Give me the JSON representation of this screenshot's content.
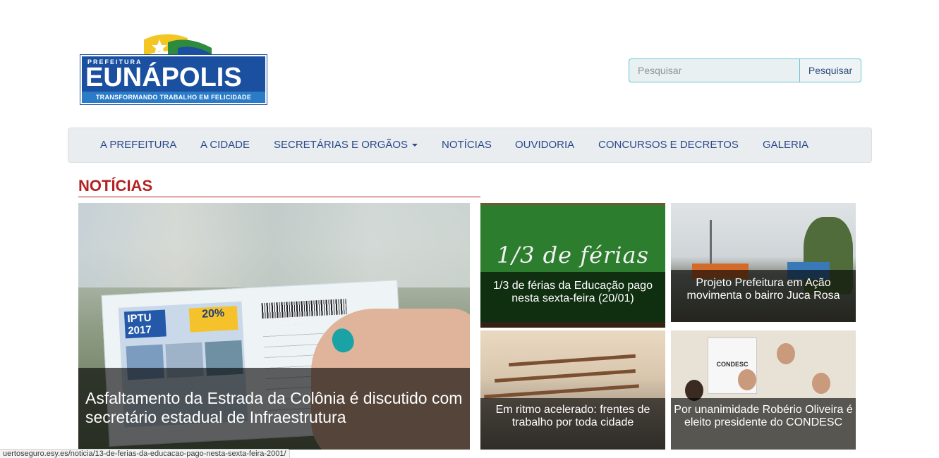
{
  "logo": {
    "prefix": "PREFEITURA",
    "name": "EUNÁPOLIS",
    "slogan": "TRANSFORMANDO TRABALHO EM FELICIDADE"
  },
  "search": {
    "placeholder": "Pesquisar",
    "button_label": "Pesquisar"
  },
  "nav": {
    "items": [
      "A PREFEITURA",
      "A CIDADE",
      "SECRETÁRIAS E ORGÃOS",
      "NOTÍCIAS",
      "OUVIDORIA",
      "CONCURSOS E DECRETOS",
      "GALERIA"
    ]
  },
  "news": {
    "section_title": "NOTÍCIAS",
    "featured": {
      "caption": "Asfaltamento da Estrada da Colônia é discutido com secretário estadual de Infraestrutura",
      "image_text": {
        "iptu": "IPTU 2017",
        "discount": "20%"
      }
    },
    "items": [
      {
        "caption": "1/3 de férias da Educação pago nesta sexta-feira (20/01)",
        "image_text": "1/3 de férias"
      },
      {
        "caption": "Projeto Prefeitura em Ação movimenta o bairro Juca Rosa"
      },
      {
        "caption": "Em ritmo acelerado: frentes de trabalho por toda cidade"
      },
      {
        "caption": "Por unanimidade Robério Oliveira é eleito presidente do CONDESC",
        "image_text": "CONDESC"
      }
    ]
  },
  "status_bar": {
    "url": "uertoseguro.esy.es/noticia/13-de-ferias-da-educacao-pago-nesta-sexta-feira-2001/"
  },
  "colors": {
    "accent_red": "#b22222",
    "nav_text": "#2a4a8c",
    "logo_blue": "#1b4fa0"
  }
}
